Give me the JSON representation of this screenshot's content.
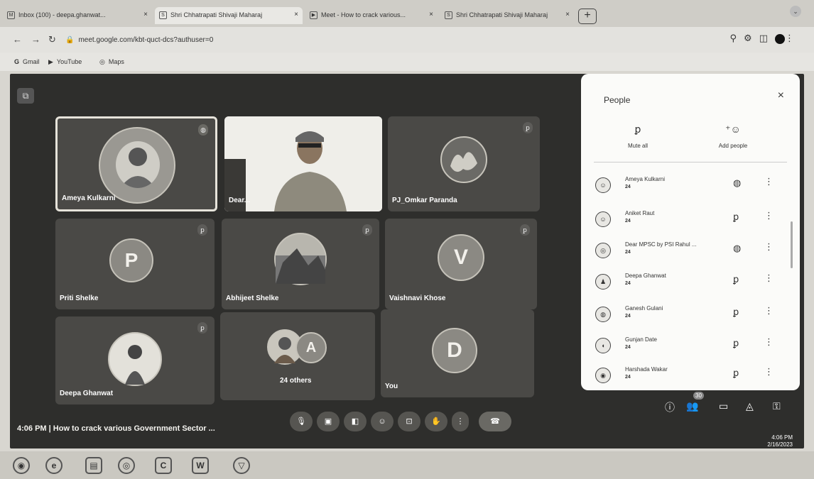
{
  "browser": {
    "tabs": [
      {
        "label": "Inbox (100) - deepa.ghanwat...",
        "icon": "M"
      },
      {
        "label": "Shri Chhatrapati Shivaji Maharaj",
        "icon": "S"
      },
      {
        "label": "Meet - How to crack various...",
        "icon": "▶"
      },
      {
        "label": "Shri Chhatrapati Shivaji Maharaj",
        "icon": "S"
      }
    ],
    "new_tab": "+",
    "url": "meet.google.com/kbt-quct-dcs?authuser=0",
    "bookmarks": [
      {
        "icon": "G",
        "label": "Gmail"
      },
      {
        "icon": "▶",
        "label": "YouTube"
      },
      {
        "icon": "◎",
        "label": "Maps"
      }
    ]
  },
  "meeting": {
    "tiles": [
      {
        "name": "Ameya Kulkarni",
        "kind": "photo",
        "active": true
      },
      {
        "name": "Dear...",
        "kind": "video"
      },
      {
        "name": "PJ_Omkar Paranda",
        "kind": "photo"
      },
      {
        "name": "Priti Shelke",
        "kind": "letter",
        "letter": "P"
      },
      {
        "name": "Abhijeet Shelke",
        "kind": "photo"
      },
      {
        "name": "Vaishnavi Khose",
        "kind": "letter",
        "letter": "V"
      },
      {
        "name": "Deepa Ghanwat",
        "kind": "photo"
      },
      {
        "name": "24 others",
        "kind": "group",
        "letter": "A"
      },
      {
        "name": "You",
        "kind": "letter",
        "letter": "D"
      }
    ],
    "time": "4:06 PM",
    "separator": "|",
    "meeting_title": "How to crack various Government Sector ...",
    "participant_badge": "30"
  },
  "people_panel": {
    "title": "People",
    "close": "×",
    "mute_all": "Mute all",
    "add_people": "Add people",
    "participants": [
      {
        "name": "Ameya Kulkarni",
        "sub": "24",
        "status": "speaking"
      },
      {
        "name": "Aniket Raut",
        "sub": "24",
        "status": "muted"
      },
      {
        "name": "Dear MPSC by PSI Rahul ...",
        "sub": "24",
        "status": "speaking"
      },
      {
        "name": "Deepa Ghanwat",
        "sub": "24",
        "status": "muted"
      },
      {
        "name": "Ganesh Gulani",
        "sub": "24",
        "status": "muted"
      },
      {
        "name": "Gunjan Date",
        "sub": "24",
        "status": "muted"
      },
      {
        "name": "Harshada Wakar",
        "sub": "24",
        "status": "muted"
      }
    ]
  },
  "taskbar": {
    "apps": [
      "◉",
      "e",
      "▤",
      "◎",
      "C",
      "W",
      "▽"
    ],
    "clock": "4:06 PM",
    "date": "2/16/2023"
  }
}
